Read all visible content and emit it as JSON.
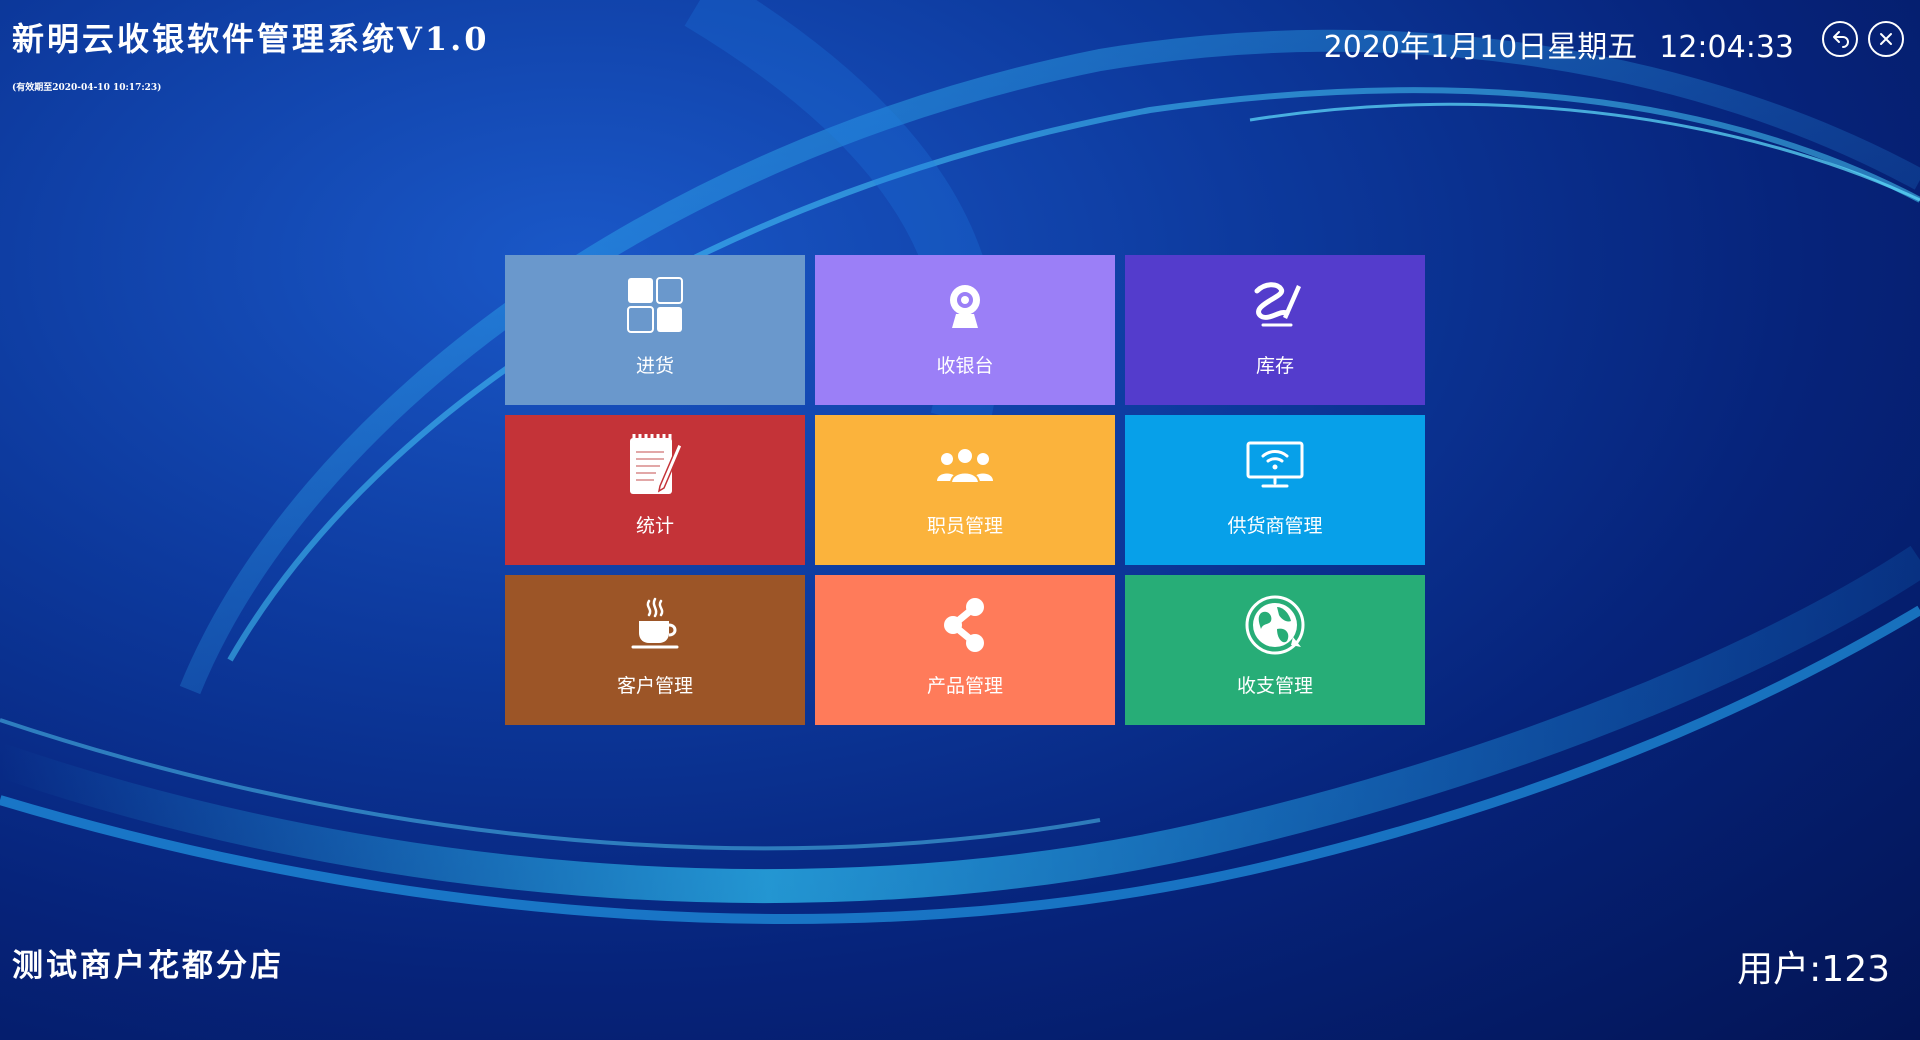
{
  "header": {
    "app_title": "新明云收银软件管理系统V1.0",
    "expiry": "(有效期至2020-04-10 10:17:23)",
    "date": "2020年1月10日星期五",
    "time": "12:04:33"
  },
  "tiles": [
    {
      "label": "进货",
      "color": "#6a98cc",
      "icon": "grid-icon"
    },
    {
      "label": "收银台",
      "color": "#9b7ff7",
      "icon": "webcam-icon"
    },
    {
      "label": "库存",
      "color": "#543ccc",
      "icon": "sign-icon"
    },
    {
      "label": "统计",
      "color": "#c43338",
      "icon": "notepad-icon"
    },
    {
      "label": "职员管理",
      "color": "#fbb33c",
      "icon": "users-icon"
    },
    {
      "label": "供货商管理",
      "color": "#07a0e9",
      "icon": "wifi-monitor-icon"
    },
    {
      "label": "客户管理",
      "color": "#9c5527",
      "icon": "coffee-cup-icon"
    },
    {
      "label": "产品管理",
      "color": "#ff7b5a",
      "icon": "share-icon"
    },
    {
      "label": "收支管理",
      "color": "#27ad77",
      "icon": "globe-icon"
    }
  ],
  "footer": {
    "store_name": "测试商户花都分店",
    "user_label": "用户:123"
  }
}
